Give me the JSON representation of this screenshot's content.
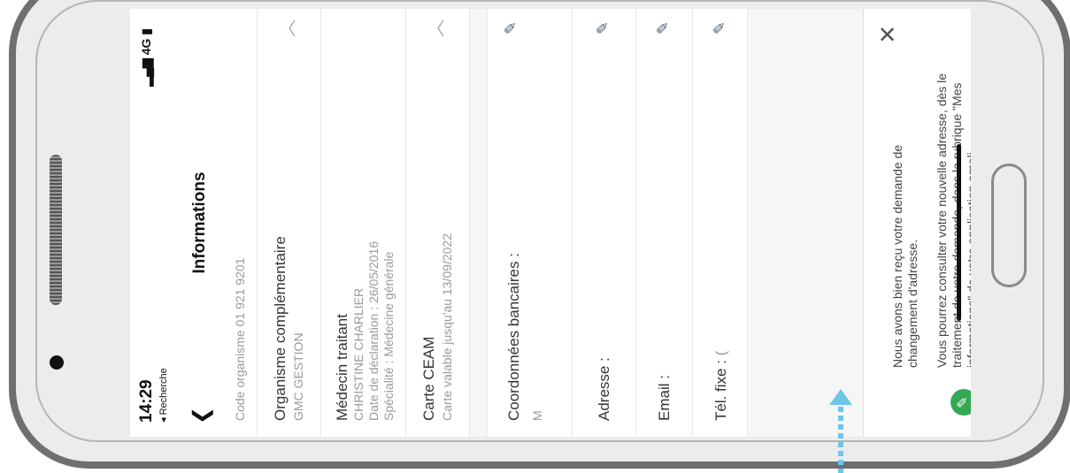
{
  "status_bar": {
    "time": "14:29",
    "back_app": "◂ Recherche",
    "signal": "4G"
  },
  "header": {
    "back_icon": "chevron-left-icon",
    "title": "Informations"
  },
  "rows": {
    "code": {
      "label": "Code organisme 01 921 9201"
    },
    "organisme": {
      "title": "Organisme complémentaire",
      "subtitle": "GMC GESTION"
    },
    "medecin": {
      "title": "Médecin traitant",
      "line1": "CHRISTINE CHARLIER",
      "line2": "Date de déclaration : 26/05/2016",
      "line3": "Spécialité : Médecine générale"
    },
    "ceam": {
      "title": "Carte CEAM",
      "subtitle": "Carte valable jusqu'au 13/09/2022"
    },
    "banque": {
      "title": "Coordonnées bancaires :",
      "value": "M"
    },
    "adresse": {
      "title": "Adresse :"
    },
    "email": {
      "title": "Email :"
    },
    "tel": {
      "title": "Tél. fixe :",
      "value": "("
    }
  },
  "notification": {
    "message1": "Nous avons bien reçu votre demande de changement d'adresse.",
    "message2": "Vous pourrez consulter votre nouvelle adresse, dès le traitement de votre demande, dans la rubrique \"Mes informations\" de votre application ameli."
  },
  "icons": [
    "edit-pencil-icon",
    "chevron-up-icon",
    "close-icon"
  ]
}
